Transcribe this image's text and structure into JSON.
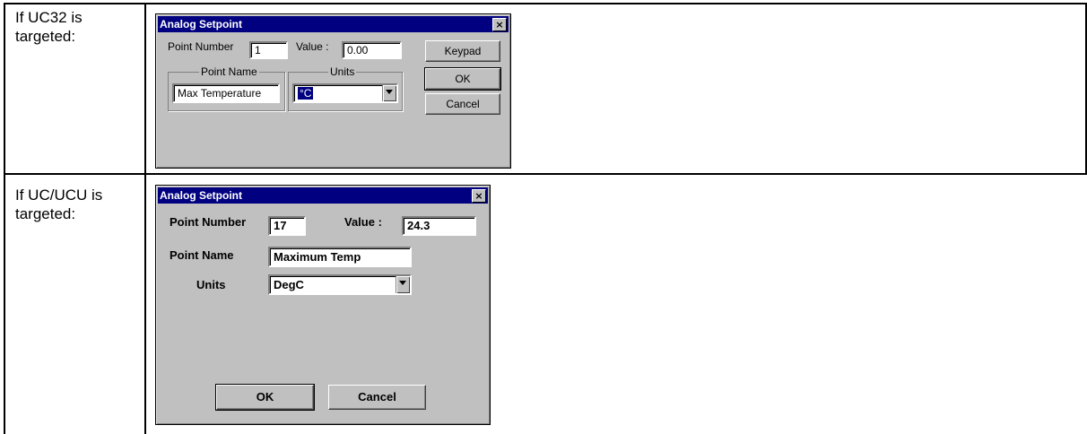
{
  "rows": [
    {
      "label": "If UC32 is\ntargeted:",
      "dialog": {
        "title": "Analog Setpoint",
        "close": "×",
        "point_number_label": "Point Number",
        "point_number_value": "1",
        "value_label": "Value :",
        "value_value": "0.00",
        "point_name_group": "Point Name",
        "point_name_value": "Max Temperature",
        "units_group": "Units",
        "units_value": "°C",
        "keypad_button": "Keypad",
        "ok_button": "OK",
        "cancel_button": "Cancel"
      }
    },
    {
      "label": "If UC/UCU is\ntargeted:",
      "dialog": {
        "title": "Analog Setpoint",
        "close": "×",
        "point_number_label": "Point Number",
        "point_number_value": "17",
        "value_label": "Value :",
        "value_value": "24.3",
        "point_name_label": "Point Name",
        "point_name_value": "Maximum Temp",
        "units_label": "Units",
        "units_value": "DegC",
        "ok_button": "OK",
        "cancel_button": "Cancel"
      }
    }
  ]
}
